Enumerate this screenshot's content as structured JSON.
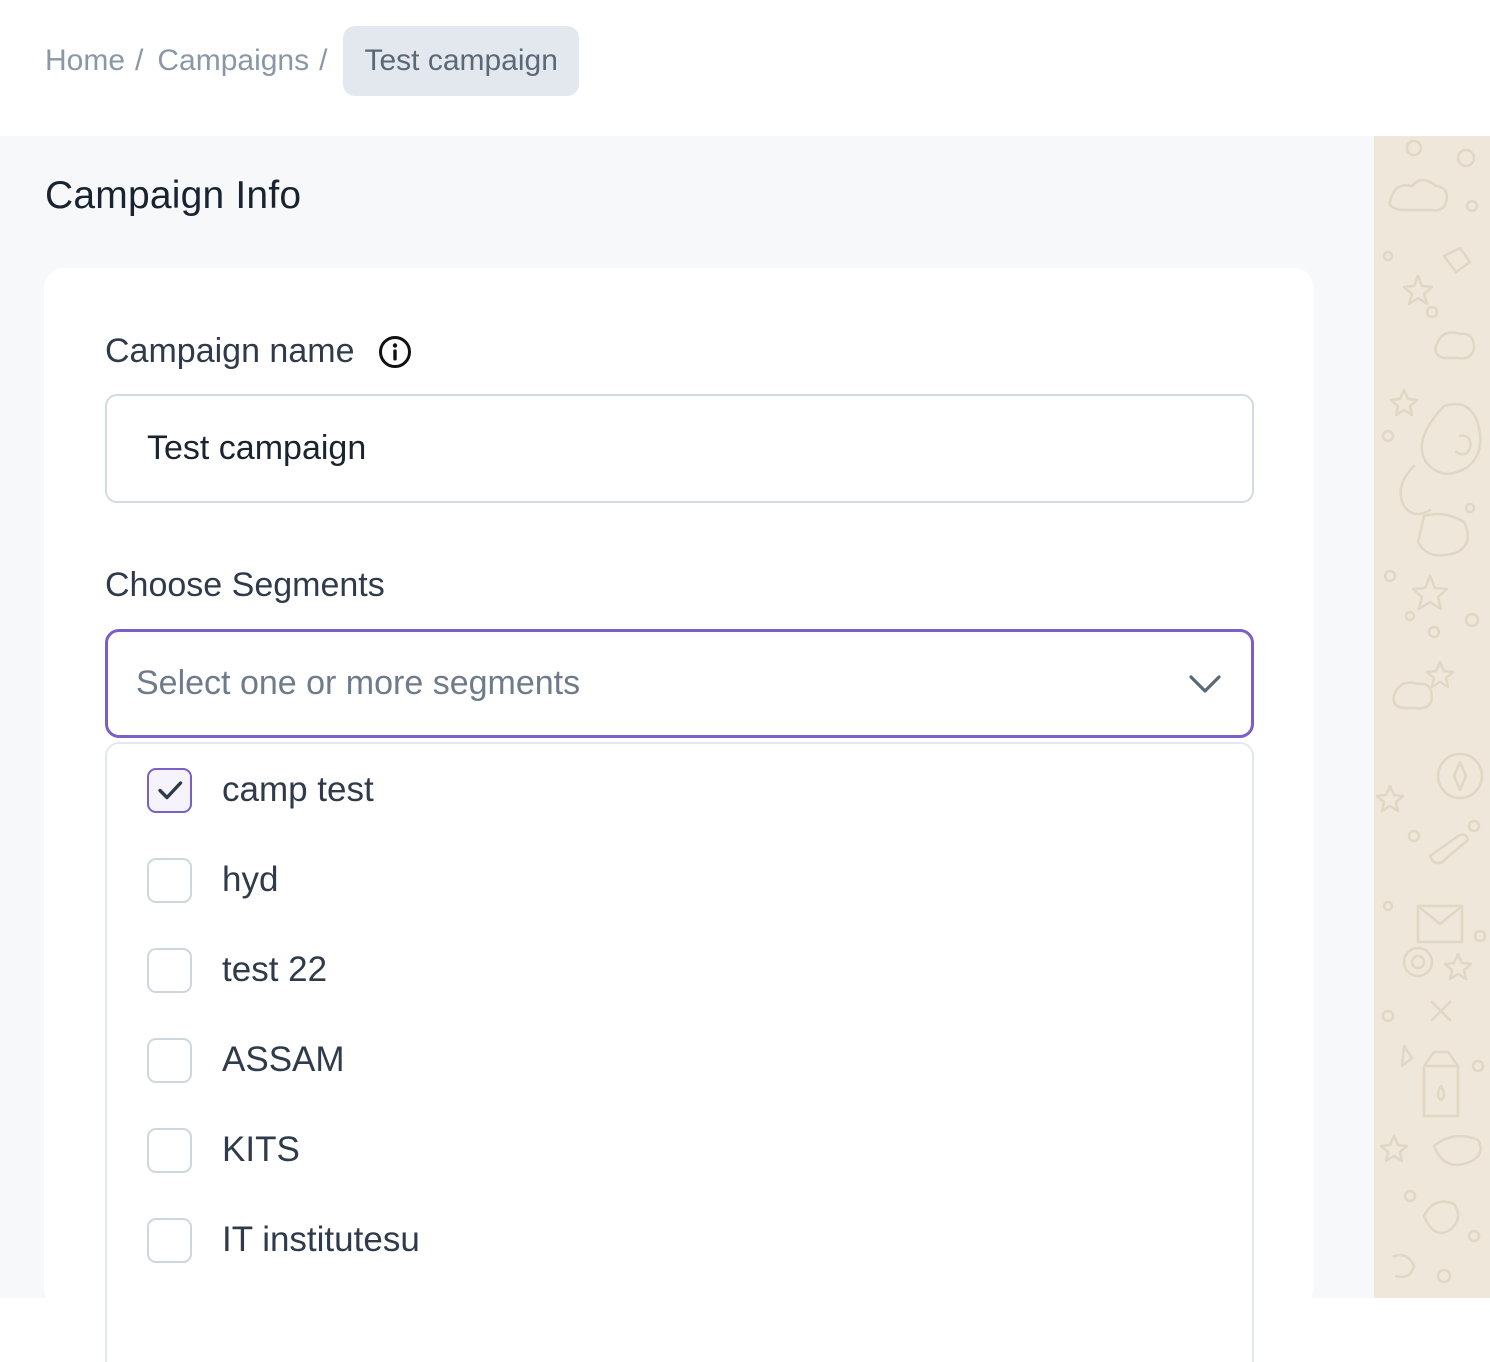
{
  "breadcrumb": {
    "home": "Home",
    "campaigns": "Campaigns",
    "separator": "/",
    "current": "Test campaign"
  },
  "section": {
    "title": "Campaign Info"
  },
  "form": {
    "campaign_name_label": "Campaign name",
    "campaign_name_value": "Test campaign",
    "segments_label": "Choose Segments",
    "segments_placeholder": "Select one or more segments"
  },
  "segments": {
    "options": [
      {
        "label": "camp test",
        "checked": true
      },
      {
        "label": "hyd",
        "checked": false
      },
      {
        "label": "test 22",
        "checked": false
      },
      {
        "label": "ASSAM",
        "checked": false
      },
      {
        "label": "KITS",
        "checked": false
      },
      {
        "label": "IT institutesu",
        "checked": false
      }
    ]
  },
  "colors": {
    "accent": "#7b5fc8",
    "side_panel": "#efe7da"
  },
  "icons": {
    "info": "info-icon",
    "chevron": "chevron-down-icon",
    "check": "check-icon"
  }
}
